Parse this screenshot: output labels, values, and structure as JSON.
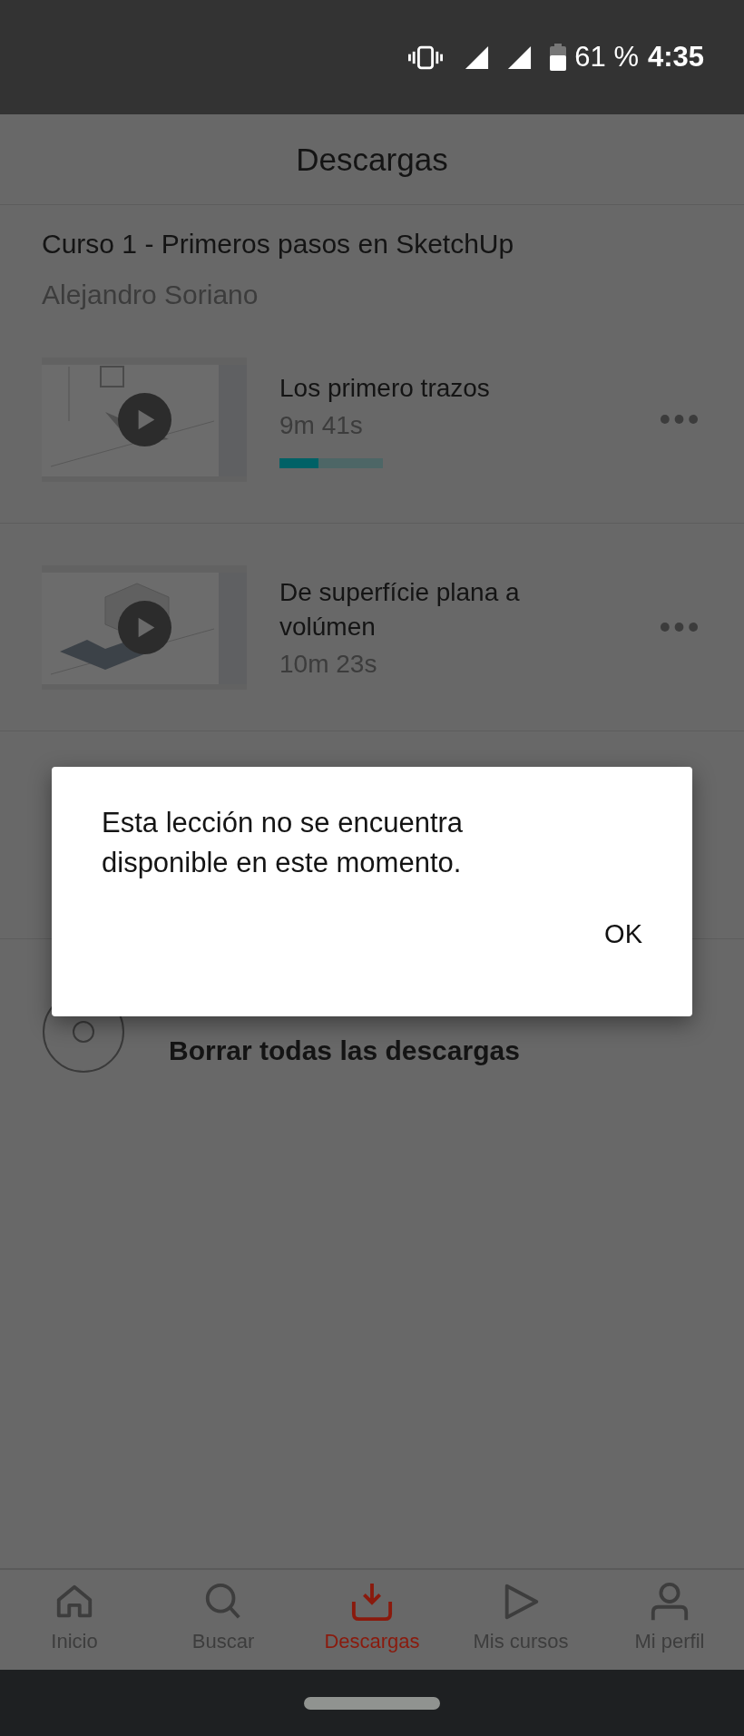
{
  "status_bar": {
    "battery": "61 %",
    "time": "4:35"
  },
  "header": {
    "title": "Descargas"
  },
  "course": {
    "title": "Curso 1 - Primeros pasos en SketchUp",
    "author": "Alejandro Soriano"
  },
  "lessons": [
    {
      "title": "Los primero trazos",
      "duration": "9m 41s",
      "level": 0.38
    },
    {
      "title": "De superfície plana a volúmen",
      "duration": "10m 23s"
    }
  ],
  "delete_all": {
    "label": "Borrar todas las descargas"
  },
  "dialog": {
    "message": "Esta lección no se encuentra disponible en este momento.",
    "button": "OK"
  },
  "nav": [
    {
      "label": "Inicio",
      "kind": "home",
      "selected": false
    },
    {
      "label": "Buscar",
      "kind": "search",
      "selected": false
    },
    {
      "label": "Descargas",
      "kind": "download",
      "selected": true
    },
    {
      "label": "Mis cursos",
      "kind": "play",
      "selected": false
    },
    {
      "label": "Mi perfil",
      "kind": "person",
      "selected": false
    }
  ]
}
